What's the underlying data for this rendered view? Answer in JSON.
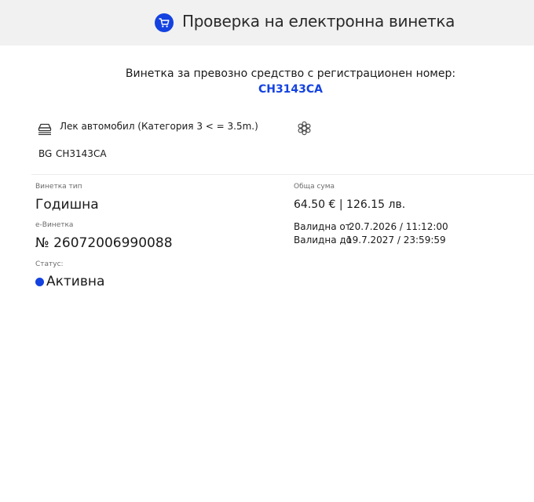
{
  "header": {
    "title": "Проверка на електронна винетка",
    "icon": "cart-icon",
    "accent": "#1442e0"
  },
  "vehicle": {
    "subtitle": "Винетка за превозно средство с регистрационен номер:",
    "plate_link": "CH3143CA",
    "category": "Лек автомобил (Категория 3 < = 3.5m.)",
    "category_icon": "car-icon",
    "emission_icon": "emission-class-icon",
    "country": "BG",
    "plate": "CH3143CA"
  },
  "vignette": {
    "type_label": "Винетка тип",
    "type_value": "Годишна",
    "number_label": "е-Винетка",
    "number_value": "№ 26072006990088",
    "status_label": "Статус:",
    "status_value": "Активна",
    "status_color": "#1442e0",
    "total_label": "Обща сума",
    "total_value": "64.50 € | 126.15 лв.",
    "valid_from_label": "Валидна от",
    "valid_from_value": "20.7.2026 / 11:12:00",
    "valid_to_label": "Валидна до",
    "valid_to_value": "19.7.2027 / 23:59:59"
  }
}
